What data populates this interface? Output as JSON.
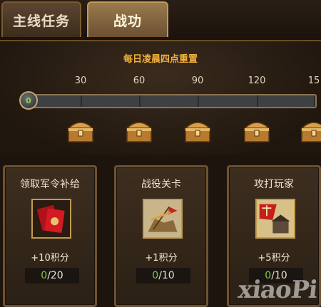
{
  "tabs": [
    {
      "label": "主线任务",
      "active": false
    },
    {
      "label": "战功",
      "active": true
    }
  ],
  "progress": {
    "reset_note": "每日凌晨四点重置",
    "current_value": "0",
    "milestones": [
      "30",
      "60",
      "90",
      "120",
      "15"
    ]
  },
  "tasks": [
    {
      "title": "领取军令补给",
      "points": "+10积分",
      "current": "0",
      "total": "/20"
    },
    {
      "title": "战役关卡",
      "points": "+1积分",
      "current": "0",
      "total": "/10"
    },
    {
      "title": "攻打玩家",
      "points": "+5积分",
      "current": "0",
      "total": "/10"
    }
  ],
  "watermark": "xiaoPi",
  "colors": {
    "accent": "#f2b23a",
    "progress_value": "#7ccc3e"
  }
}
